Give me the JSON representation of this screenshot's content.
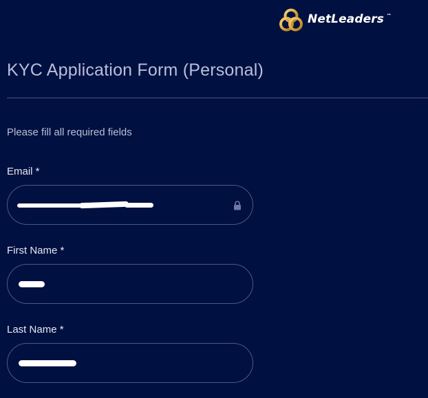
{
  "brand": {
    "name": "NetLeaders",
    "trademark": "™",
    "logo_icon": "gold-knot-icon",
    "colors": {
      "background": "#001040",
      "gold": "#d9a33a",
      "text": "#ffffff"
    }
  },
  "page": {
    "title": "KYC Application Form (Personal)",
    "instructions": "Please fill all required fields"
  },
  "form": {
    "email": {
      "label": "Email *",
      "value": "",
      "locked": true,
      "icon": "lock-icon"
    },
    "first_name": {
      "label": "First Name *",
      "value": ""
    },
    "last_name": {
      "label": "Last Name *",
      "value": ""
    }
  }
}
